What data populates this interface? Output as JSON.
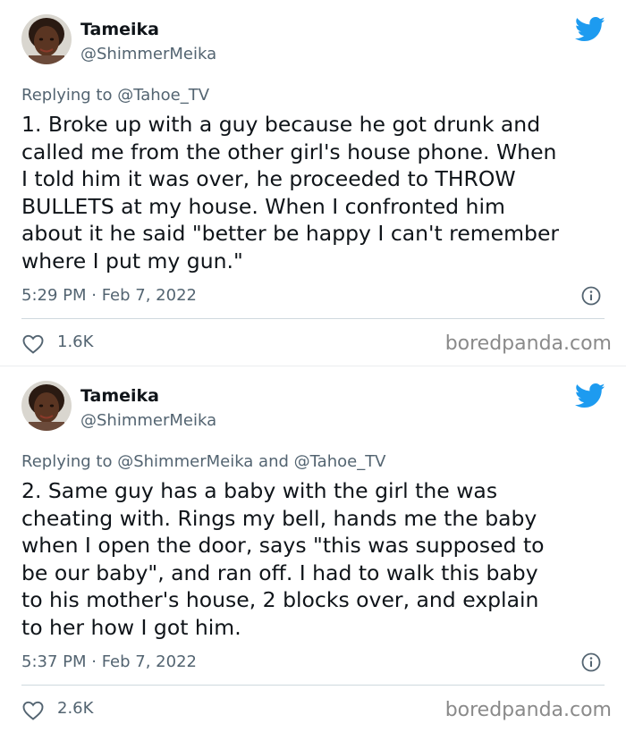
{
  "brand_color": "#1d9bf0",
  "tweets": [
    {
      "display_name": "Tameika",
      "handle": "@ShimmerMeika",
      "reply_prefix": "Replying to",
      "reply_to": "@Tahoe_TV",
      "text": "1. Broke up with a guy because he got drunk and\ncalled me from the other girl's house phone. When\nI told him it was over, he proceeded to THROW\nBULLETS at my house. When I confronted him\nabout it he said \"better be happy I can't remember\nwhere I put my gun.\"",
      "timestamp": "5:29 PM · Feb 7, 2022",
      "likes": "1.6K",
      "watermark": "boredpanda.com",
      "icons": [
        "avatar",
        "twitter-bird-icon",
        "info-icon",
        "heart-icon"
      ]
    },
    {
      "display_name": "Tameika",
      "handle": "@ShimmerMeika",
      "reply_prefix": "Replying to",
      "reply_to": "@ShimmerMeika and @Tahoe_TV",
      "text": "2. Same guy has a baby with the girl the was\ncheating with. Rings my bell, hands me the baby\nwhen I open the door, says \"this was supposed to\nbe our baby\", and ran off. I had to walk this baby\nto his mother's house, 2 blocks over, and explain\nto her how I got him.",
      "timestamp": "5:37 PM · Feb 7, 2022",
      "likes": "2.6K",
      "watermark": "boredpanda.com",
      "icons": [
        "avatar",
        "twitter-bird-icon",
        "info-icon",
        "heart-icon"
      ]
    }
  ]
}
